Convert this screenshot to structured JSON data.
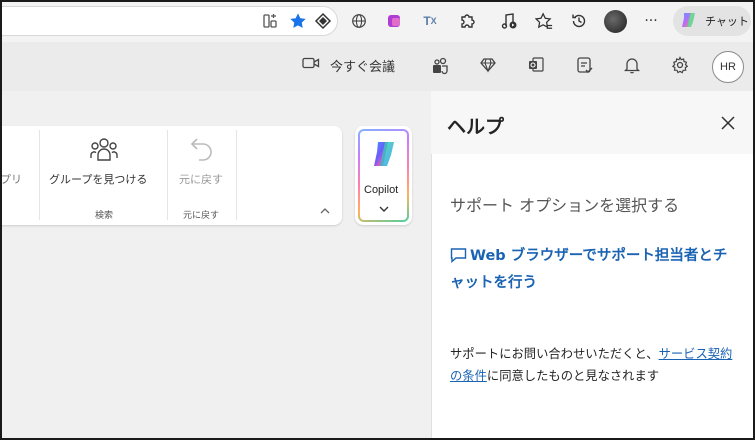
{
  "browser": {
    "chat_label": "チャット"
  },
  "teams_header": {
    "meet_now_label": "今すぐ会議",
    "user_initials": "HR"
  },
  "ribbon": {
    "apps_partial_label": "プリ",
    "find_groups_label": "グループを見つける",
    "search_group_label": "検索",
    "undo_label": "元に戻す",
    "undo_group_label": "元に戻す",
    "copilot_label": "Copilot"
  },
  "help_panel": {
    "title": "ヘルプ",
    "subtitle": "サポート オプションを選択する",
    "chat_link": "Web ブラウザーでサポート担当者とチャットを行う",
    "note_prefix": "サポートにお問い合わせいただくと、",
    "note_link": "サービス契約の条件",
    "note_suffix": "に同意したものと見なされます"
  },
  "colors": {
    "accent_link": "#1a63b3",
    "favorite_star": "#1a73e8"
  },
  "icons": [
    "split-screen-icon",
    "favorite-star-icon",
    "extension-diamond-icon",
    "globe-icon",
    "office-icon",
    "translate-icon",
    "extensions-puzzle-icon",
    "media-icon",
    "favorites-icon",
    "history-icon",
    "more-icon",
    "copilot-icon",
    "video-camera-icon",
    "teams-people-icon",
    "gem-icon",
    "outlook-icon",
    "checklist-icon",
    "bell-icon",
    "settings-gear-icon",
    "people-group-icon",
    "undo-icon",
    "close-icon",
    "chat-bubble-icon",
    "chevron-down-icon",
    "chevron-up-icon"
  ]
}
